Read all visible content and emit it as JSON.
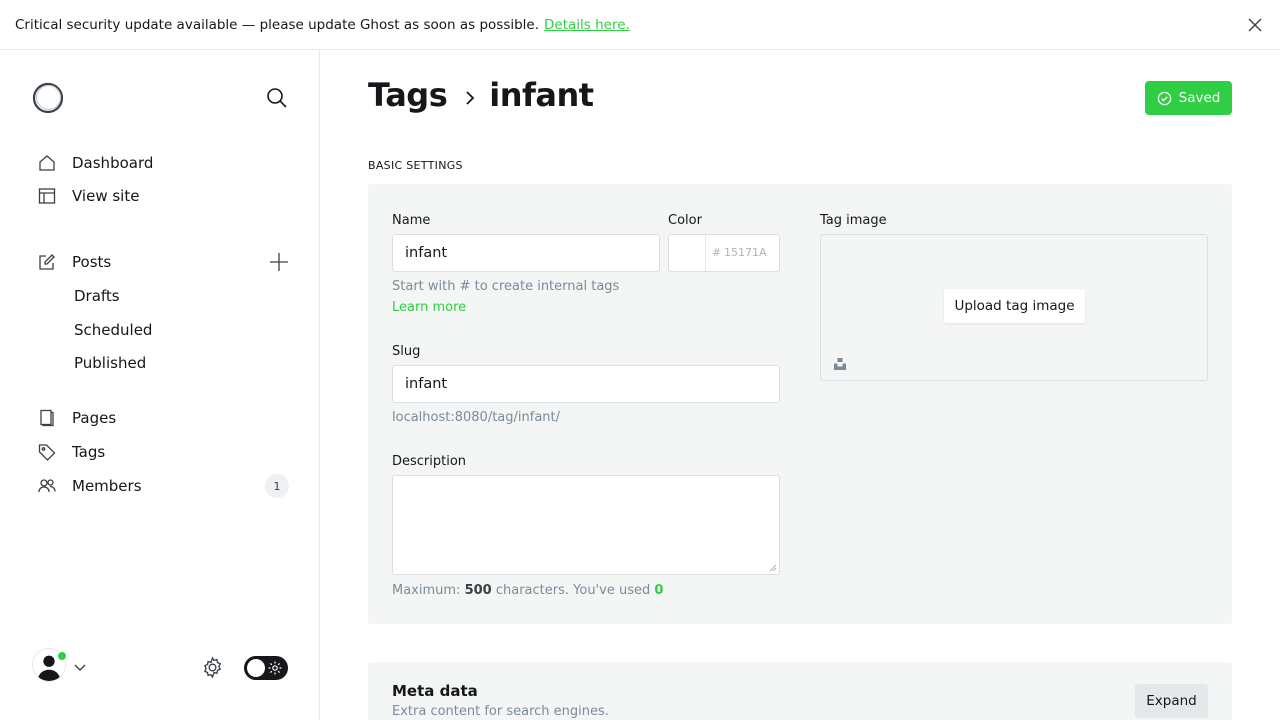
{
  "alert": {
    "message": "Critical security update available — please update Ghost as soon as possible.",
    "link": "Details here."
  },
  "sidebar": {
    "items": [
      {
        "label": "Dashboard",
        "icon": "home-icon"
      },
      {
        "label": "View site",
        "icon": "layout-icon"
      },
      {
        "label": "Posts",
        "icon": "edit-icon"
      },
      {
        "label": "Pages",
        "icon": "page-icon"
      },
      {
        "label": "Tags",
        "icon": "tag-icon"
      },
      {
        "label": "Members",
        "icon": "members-icon"
      }
    ],
    "sub_items": [
      "Drafts",
      "Scheduled",
      "Published"
    ],
    "members_count": "1"
  },
  "header": {
    "parent": "Tags",
    "current": "infant",
    "saved_label": "Saved"
  },
  "basic": {
    "section_title": "BASIC SETTINGS",
    "name_label": "Name",
    "name_value": "infant",
    "name_hint": "Start with # to create internal tags",
    "learn_more": "Learn more",
    "color_label": "Color",
    "color_hash": "#",
    "color_placeholder": "15171A",
    "slug_label": "Slug",
    "slug_value": "infant",
    "slug_url": "localhost:8080/tag/infant/",
    "description_label": "Description",
    "desc_hint_1": "Maximum:",
    "desc_max": "500",
    "desc_hint_2": "characters. You've used",
    "desc_used": "0",
    "tag_image_label": "Tag image",
    "upload_label": "Upload tag image"
  },
  "meta": {
    "title": "Meta data",
    "description": "Extra content for search engines.",
    "expand_label": "Expand"
  },
  "colors": {
    "accent": "#30cf43",
    "text": "#15171a",
    "panel": "#f4f5f5"
  }
}
